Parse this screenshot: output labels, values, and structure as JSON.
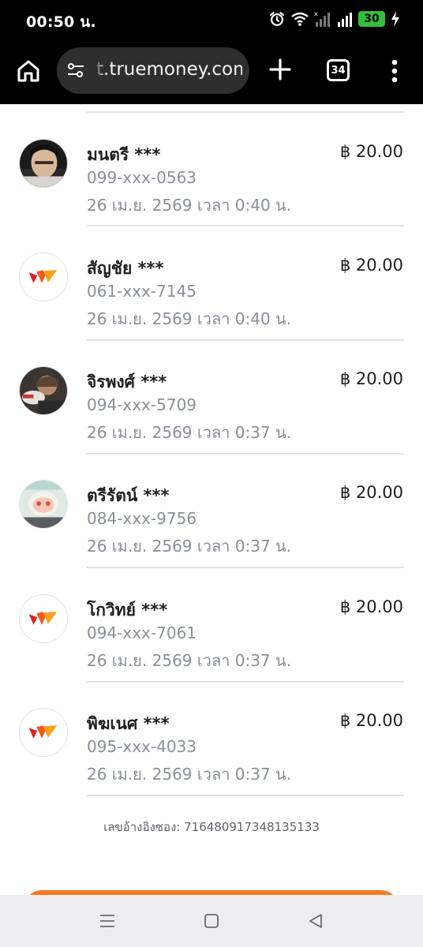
{
  "status_bar": {
    "time": "00:50 น.",
    "battery": "30",
    "icons": [
      "alarm-icon",
      "wifi-icon",
      "signal-icon",
      "signal-icon",
      "battery-icon",
      "charging-icon"
    ]
  },
  "browser": {
    "url": "t.truemoney.com",
    "tab_count": "34",
    "icons": [
      "home-icon",
      "tune-icon",
      "plus-icon",
      "tab-switcher-icon",
      "more-vert-icon"
    ]
  },
  "transactions": [
    {
      "name": "มนตรี ***",
      "phone": "099-xxx-0563",
      "datetime": "26 เม.ย. 2569 เวลา 0:40 น.",
      "amount": "฿ 20.00",
      "avatar": "photo"
    },
    {
      "name": "สัญชัย ***",
      "phone": "061-xxx-7145",
      "datetime": "26 เม.ย. 2569 เวลา 0:40 น.",
      "amount": "฿ 20.00",
      "avatar": "truemoney-logo"
    },
    {
      "name": "จิรพงศ์ ***",
      "phone": "094-xxx-5709",
      "datetime": "26 เม.ย. 2569 เวลา 0:37 น.",
      "amount": "฿ 20.00",
      "avatar": "photo"
    },
    {
      "name": "ตรีรัตน์ ***",
      "phone": "084-xxx-9756",
      "datetime": "26 เม.ย. 2569 เวลา 0:37 น.",
      "amount": "฿ 20.00",
      "avatar": "photo"
    },
    {
      "name": "โกวิทย์ ***",
      "phone": "094-xxx-7061",
      "datetime": "26 เม.ย. 2569 เวลา 0:37 น.",
      "amount": "฿ 20.00",
      "avatar": "truemoney-logo"
    },
    {
      "name": "พิฆเนศ ***",
      "phone": "095-xxx-4033",
      "datetime": "26 เม.ย. 2569 เวลา 0:37 น.",
      "amount": "฿ 20.00",
      "avatar": "truemoney-logo"
    }
  ],
  "reference": "เลขอ้างอิงซอง: 716480917348135133",
  "colors": {
    "accent": "#f47a20",
    "muted_text": "#8a8f98",
    "toolbar": "#000000"
  },
  "navbar": {
    "icons": [
      "recents-icon",
      "home-square-icon",
      "back-triangle-icon"
    ]
  }
}
